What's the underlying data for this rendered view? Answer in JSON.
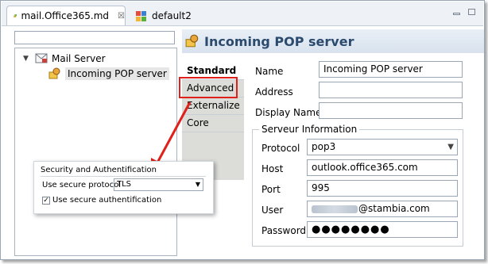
{
  "tabs": [
    {
      "label": "mail.Office365.md",
      "close": "☒",
      "icon": "database-icon"
    },
    {
      "label": "default2",
      "icon": "model-icon"
    }
  ],
  "tree": {
    "root": {
      "label": "Mail Server",
      "icon": "mail-server-icon"
    },
    "child": {
      "label": "Incoming POP server",
      "icon": "pop-server-icon"
    }
  },
  "header": {
    "title": "Incoming POP server",
    "icon": "pop-server-icon"
  },
  "vtabs": [
    "Standard",
    "Advanced",
    "Externalize",
    "Core"
  ],
  "form": {
    "name_label": "Name",
    "name_value": "Incoming POP server",
    "address_label": "Address",
    "address_value": "",
    "display_label": "Display Name",
    "display_value": "",
    "group_title": "Serveur Information",
    "protocol_label": "Protocol",
    "protocol_value": "pop3",
    "host_label": "Host",
    "host_value": "outlook.office365.com",
    "port_label": "Port",
    "port_value": "995",
    "user_label": "User",
    "user_value": "@stambia.com",
    "password_label": "Password",
    "password_value": "●●●●●●●●"
  },
  "inset": {
    "section": "Security and Authentification",
    "protocol_label": "Use secure protocol",
    "protocol_value": "TLS",
    "auth_label": "Use secure authentification",
    "auth_checked": "✓"
  },
  "colors": {
    "highlight": "#e0201b",
    "header_text": "#2b4a6e"
  }
}
